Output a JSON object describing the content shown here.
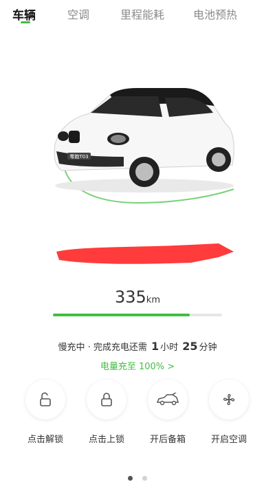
{
  "tabs": [
    {
      "label": "车辆",
      "active": true
    },
    {
      "label": "空调",
      "active": false
    },
    {
      "label": "里程能耗",
      "active": false
    },
    {
      "label": "电池预热",
      "active": false
    }
  ],
  "vehicle": {
    "plate_badge": "零跑T03",
    "range_value": "335",
    "range_unit": "km",
    "charge_level": 0.81
  },
  "charging": {
    "status_prefix": "慢充中 · 完成充电还需",
    "hours": "1",
    "hours_unit": "小时",
    "minutes": "25",
    "minutes_unit": "分钟",
    "link_label": "电量充至 100%",
    "link_arrow": ">"
  },
  "actions": [
    {
      "label": "点击解锁",
      "icon": "unlock-icon"
    },
    {
      "label": "点击上锁",
      "icon": "lock-icon"
    },
    {
      "label": "开后备箱",
      "icon": "trunk-icon"
    },
    {
      "label": "开启空调",
      "icon": "fan-icon"
    }
  ],
  "pagination": {
    "total": 2,
    "current": 1
  },
  "colors": {
    "accent": "#3fbf3f",
    "redacted": "#ff3b3b"
  }
}
